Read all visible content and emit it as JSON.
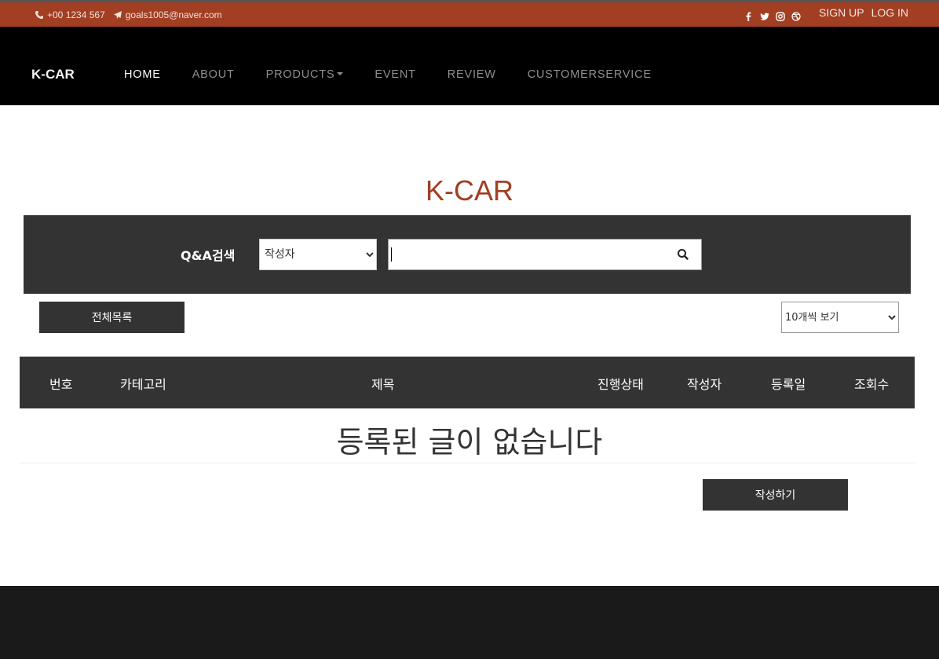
{
  "topbar": {
    "phone": "+00 1234 567",
    "email": "goals1005@naver.com",
    "social": [
      "facebook-icon",
      "twitter-icon",
      "instagram-icon",
      "dribbble-icon"
    ],
    "signup": "SIGN UP",
    "login": "LOG IN",
    "color": "#a23e22"
  },
  "nav": {
    "brand": "K-CAR",
    "items": [
      {
        "label": "HOME"
      },
      {
        "label": "ABOUT"
      },
      {
        "label": "PRODUCTS"
      },
      {
        "label": "EVENT"
      },
      {
        "label": "REVIEW"
      },
      {
        "label": "CUSTOMERSERVICE"
      }
    ]
  },
  "main": {
    "title": "K-CAR",
    "search_label": "Q&A검색",
    "search_field_selected": "작성자",
    "search_value": "",
    "list_all": "전체목록",
    "per_page_selected": "10개씩 보기",
    "columns": [
      "번호",
      "카테고리",
      "제목",
      "진행상태",
      "작성자",
      "등록일",
      "조회수"
    ],
    "empty_message": "등록된 글이 없습니다",
    "write_button": "작성하기"
  }
}
